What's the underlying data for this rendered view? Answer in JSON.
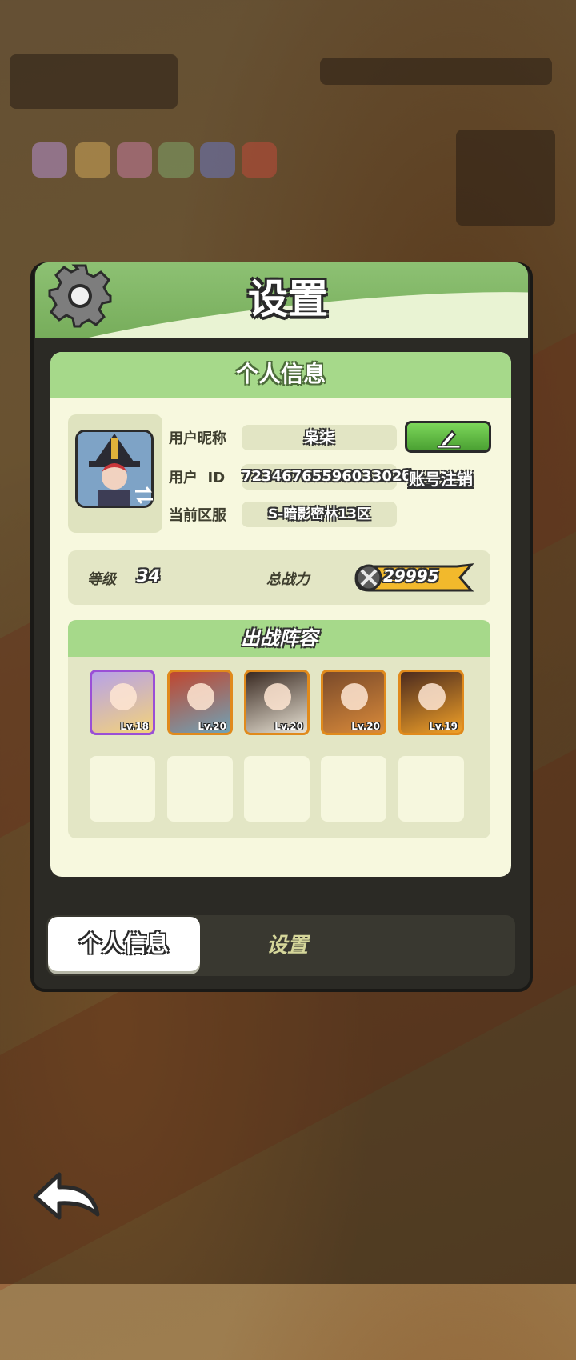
{
  "dialog": {
    "title": "设置"
  },
  "profile_panel": {
    "header": "个人信息",
    "nickname_label": "用户昵称",
    "nickname_value": "枭柒",
    "user_id_label": "用户  ID",
    "user_id_value": "7234676559603302б",
    "cancel_account": "账号注销",
    "server_label": "当前区服",
    "server_value": "S-暗影密林13区",
    "level_label": "等级",
    "level_value": "34",
    "power_label": "总战力",
    "power_value": "29995"
  },
  "lineup": {
    "title": "出战阵容",
    "heroes": [
      {
        "level": "Lv.18",
        "border": "#9a4fd6"
      },
      {
        "level": "Lv.20",
        "border": "#e08a1c"
      },
      {
        "level": "Lv.20",
        "border": "#e08a1c"
      },
      {
        "level": "Lv.20",
        "border": "#e08a1c"
      },
      {
        "level": "Lv.19",
        "border": "#e08a1c"
      }
    ]
  },
  "tabs": {
    "profile": "个人信息",
    "settings": "设置"
  },
  "icons": {
    "gear": "gear-icon",
    "edit": "pencil-icon",
    "swap": "swap-icon",
    "power": "crossed-swords-icon",
    "back": "back-arrow-icon"
  }
}
